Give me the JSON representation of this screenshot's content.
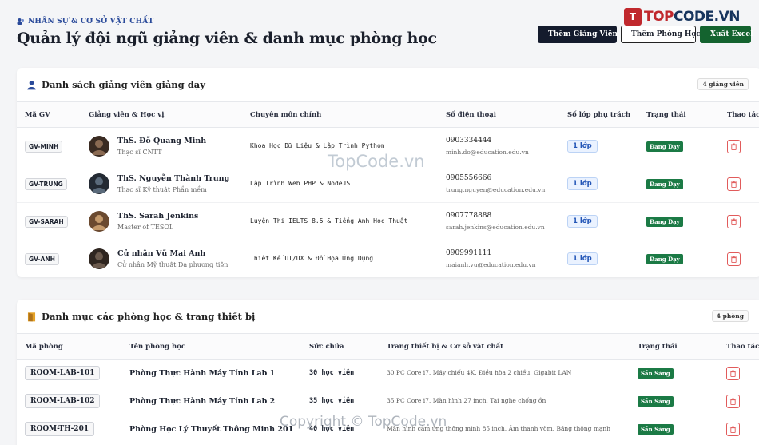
{
  "header": {
    "eyebrow": "NHÂN SỰ & CƠ SỞ VẬT CHẤT",
    "title": "Quản lý đội ngũ giảng viên & danh mục phòng học",
    "btn_add_teacher": "Thêm Giảng Viên",
    "btn_add_room": "Thêm Phòng Học",
    "btn_export": "Xuất Excel"
  },
  "logo": {
    "mark": "T",
    "text_a": "TOP",
    "text_b": "CODE.VN"
  },
  "teachers": {
    "title": "Danh sách giảng viên giảng dạy",
    "count": "4 giảng viên",
    "columns": [
      "Mã GV",
      "Giảng viên & Học vị",
      "Chuyên môn chính",
      "Số điện thoại",
      "Số lớp phụ trách",
      "Trạng thái",
      "Thao tác"
    ],
    "rows": [
      {
        "code": "GV-MINH",
        "name": "ThS. Đỗ Quang Minh",
        "degree": "Thạc sĩ CNTT",
        "major": "Khoa Học Dữ Liệu & Lập Trình Python",
        "phone": "0903334444",
        "email": "minh.do@education.edu.vn",
        "classes": "1 lớp",
        "status": "Đang Dạy"
      },
      {
        "code": "GV-TRUNG",
        "name": "ThS. Nguyễn Thành Trung",
        "degree": "Thạc sĩ Kỹ thuật Phần mềm",
        "major": "Lập Trình Web PHP & NodeJS",
        "phone": "0905556666",
        "email": "trung.nguyen@education.edu.vn",
        "classes": "1 lớp",
        "status": "Đang Dạy"
      },
      {
        "code": "GV-SARAH",
        "name": "ThS. Sarah Jenkins",
        "degree": "Master of TESOL",
        "major": "Luyện Thi IELTS 8.5 & Tiếng Anh Học Thuật",
        "phone": "0907778888",
        "email": "sarah.jenkins@education.edu.vn",
        "classes": "1 lớp",
        "status": "Đang Dạy"
      },
      {
        "code": "GV-ANH",
        "name": "Cử nhân Vũ Mai Anh",
        "degree": "Cử nhân Mỹ thuật Đa phương tiện",
        "major": "Thiết Kế UI/UX & Đồ Họa Ứng Dụng",
        "phone": "0909991111",
        "email": "maianh.vu@education.edu.vn",
        "classes": "1 lớp",
        "status": "Đang Dạy"
      }
    ]
  },
  "rooms": {
    "title": "Danh mục các phòng học & trang thiết bị",
    "count": "4 phòng",
    "columns": [
      "Mã phòng",
      "Tên phòng học",
      "Sức chứa",
      "Trang thiết bị & Cơ sở vật chất",
      "Trạng thái",
      "Thao tác"
    ],
    "rows": [
      {
        "code": "ROOM-LAB-101",
        "name": "Phòng Thực Hành Máy Tính Lab 1",
        "capacity": "30 học viên",
        "equipment": "30 PC Core i7, Máy chiếu 4K, Điều hòa 2 chiều, Gigabit LAN",
        "status": "Sẵn Sàng"
      },
      {
        "code": "ROOM-LAB-102",
        "name": "Phòng Thực Hành Máy Tính Lab 2",
        "capacity": "35 học viên",
        "equipment": "35 PC Core i7, Màn hình 27 inch, Tai nghe chống ồn",
        "status": "Sẵn Sàng"
      },
      {
        "code": "ROOM-TH-201",
        "name": "Phòng Học Lý Thuyết Thông Minh 201",
        "capacity": "40 học viên",
        "equipment": "Màn hình cảm ứng thông minh 85 inch, Âm thanh vòm, Băng thông mạnh",
        "status": "Sẵn Sàng"
      }
    ]
  },
  "watermarks": {
    "center": "TopCode.vn",
    "bottom": "Copyright © TopCode.vn"
  },
  "colors": {
    "primary_dark": "#141b2d",
    "success": "#14632f",
    "danger": "#e15b5b",
    "accent_blue": "#2356b7"
  }
}
